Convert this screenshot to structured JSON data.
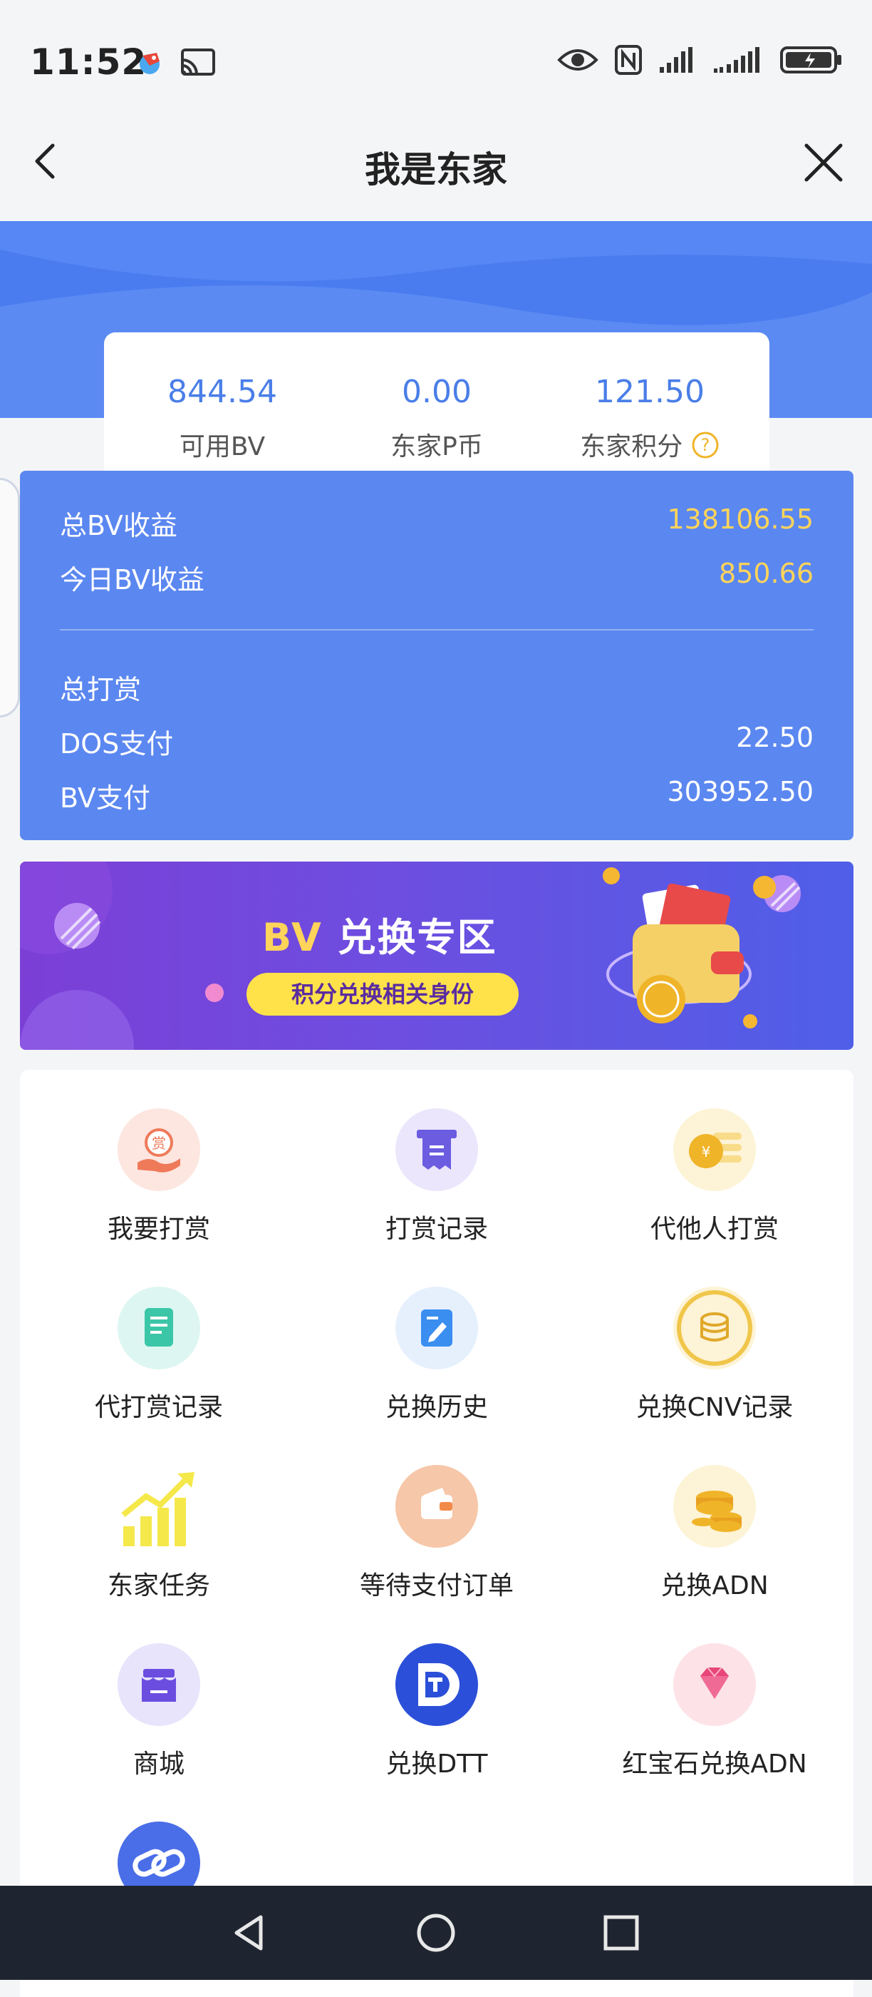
{
  "status_bar": {
    "time": "11:52"
  },
  "header": {
    "title": "我是东家"
  },
  "stats": [
    {
      "value": "844.54",
      "label": "可用BV"
    },
    {
      "value": "0.00",
      "label": "东家P币"
    },
    {
      "value": "121.50",
      "label": "东家积分"
    }
  ],
  "earnings": {
    "total_bv_label": "总BV收益",
    "total_bv_value": "138106.55",
    "today_bv_label": "今日BV收益",
    "today_bv_value": "850.66",
    "total_reward_label": "总打赏",
    "dos_label": "DOS支付",
    "dos_value": "22.50",
    "bv_pay_label": "BV支付",
    "bv_pay_value": "303952.50"
  },
  "banner": {
    "title_bv": "BV",
    "title_rest": "兑换专区",
    "pill": "积分兑换相关身份"
  },
  "grid": [
    {
      "label": "我要打赏",
      "icon": "reward-hand-icon",
      "bg": "#fde6e0"
    },
    {
      "label": "打赏记录",
      "icon": "receipt-icon",
      "bg": "#ebe6fb"
    },
    {
      "label": "代他人打赏",
      "icon": "yuan-coin-icon",
      "bg": "#fdf3d6"
    },
    {
      "label": "代打赏记录",
      "icon": "document-icon",
      "bg": "#ddf6f1"
    },
    {
      "label": "兑换历史",
      "icon": "edit-note-icon",
      "bg": "#e6f0fd"
    },
    {
      "label": "兑换CNV记录",
      "icon": "coin-stack-icon",
      "bg": "#fdf3d6"
    },
    {
      "label": "东家任务",
      "icon": "growth-chart-icon",
      "bg": "#ffffff"
    },
    {
      "label": "等待支付订单",
      "icon": "wallet-icon",
      "bg": "#f6c7a8"
    },
    {
      "label": "兑换ADN",
      "icon": "coins-pile-icon",
      "bg": "#fdf3d6"
    },
    {
      "label": "商城",
      "icon": "shop-icon",
      "bg": "#e7e4fb"
    },
    {
      "label": "兑换DTT",
      "icon": "dtt-logo-icon",
      "bg": "#2b4fd8"
    },
    {
      "label": "红宝石兑换ADN",
      "icon": "ruby-gem-icon",
      "bg": "#fde3e8"
    },
    {
      "label": "",
      "icon": "link-icon",
      "bg": "#4a6ee8"
    }
  ]
}
